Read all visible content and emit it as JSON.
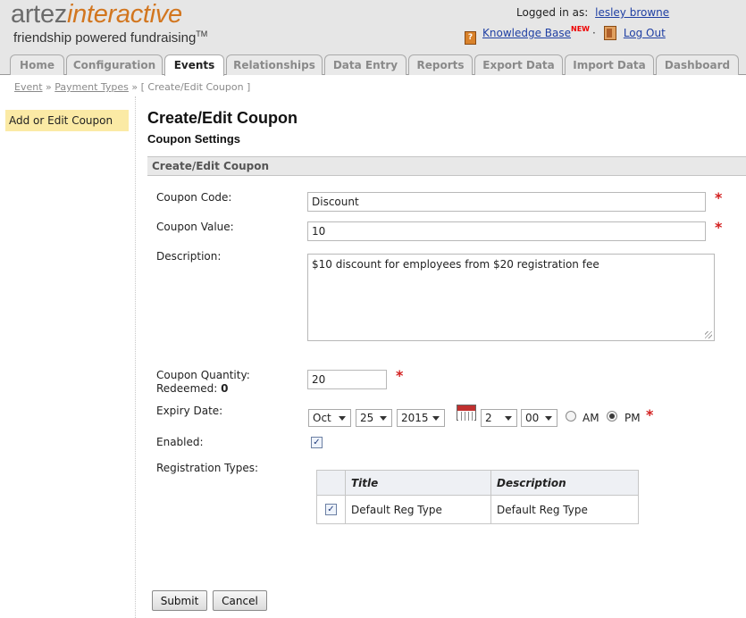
{
  "brand": {
    "part1": "artez",
    "part2": "interactive",
    "tagline": "friendship powered fundraising",
    "tm": "TM",
    "accent": "#d2761f"
  },
  "user": {
    "logged_in_label": "Logged in as:",
    "name": "lesley browne"
  },
  "top_links": {
    "knowledge_base": "Knowledge Base",
    "new_badge": "NEW",
    "separator": "·",
    "logout": "Log Out"
  },
  "tabs": [
    {
      "label": "Home"
    },
    {
      "label": "Configuration"
    },
    {
      "label": "Events",
      "active": true
    },
    {
      "label": "Relationships"
    },
    {
      "label": "Data Entry"
    },
    {
      "label": "Reports"
    },
    {
      "label": "Export Data"
    },
    {
      "label": "Import Data"
    },
    {
      "label": "Dashboard"
    }
  ],
  "breadcrumb": {
    "items": [
      "Event",
      "Payment Types"
    ],
    "sep": "»",
    "current": "[ Create/Edit Coupon ]"
  },
  "sidebar": {
    "items": [
      {
        "label": "Add or Edit Coupon",
        "active": true
      }
    ]
  },
  "page": {
    "title": "Create/Edit Coupon",
    "section": "Coupon Settings",
    "panel_title": "Create/Edit Coupon"
  },
  "form": {
    "code": {
      "label": "Coupon Code:",
      "value": "Discount"
    },
    "value": {
      "label": "Coupon Value:",
      "value": "10"
    },
    "description": {
      "label": "Description:",
      "value": "$10 discount for employees from $20 registration fee"
    },
    "quantity": {
      "label": "Coupon Quantity:",
      "value": "20",
      "redeemed_label": "Redeemed:",
      "redeemed_value": "0"
    },
    "expiry": {
      "label": "Expiry Date:",
      "month": "Oct",
      "day": "25",
      "year": "2015",
      "hour": "2",
      "minute": "00",
      "am_label": "AM",
      "pm_label": "PM",
      "period_selected": "PM"
    },
    "enabled": {
      "label": "Enabled:",
      "checked": true
    },
    "reg_types": {
      "label": "Registration Types:",
      "columns": [
        "Title",
        "Description"
      ],
      "rows": [
        {
          "checked": true,
          "title": "Default Reg Type",
          "description": "Default Reg Type"
        }
      ]
    },
    "required_mark": "*"
  },
  "actions": {
    "submit": "Submit",
    "cancel": "Cancel"
  }
}
